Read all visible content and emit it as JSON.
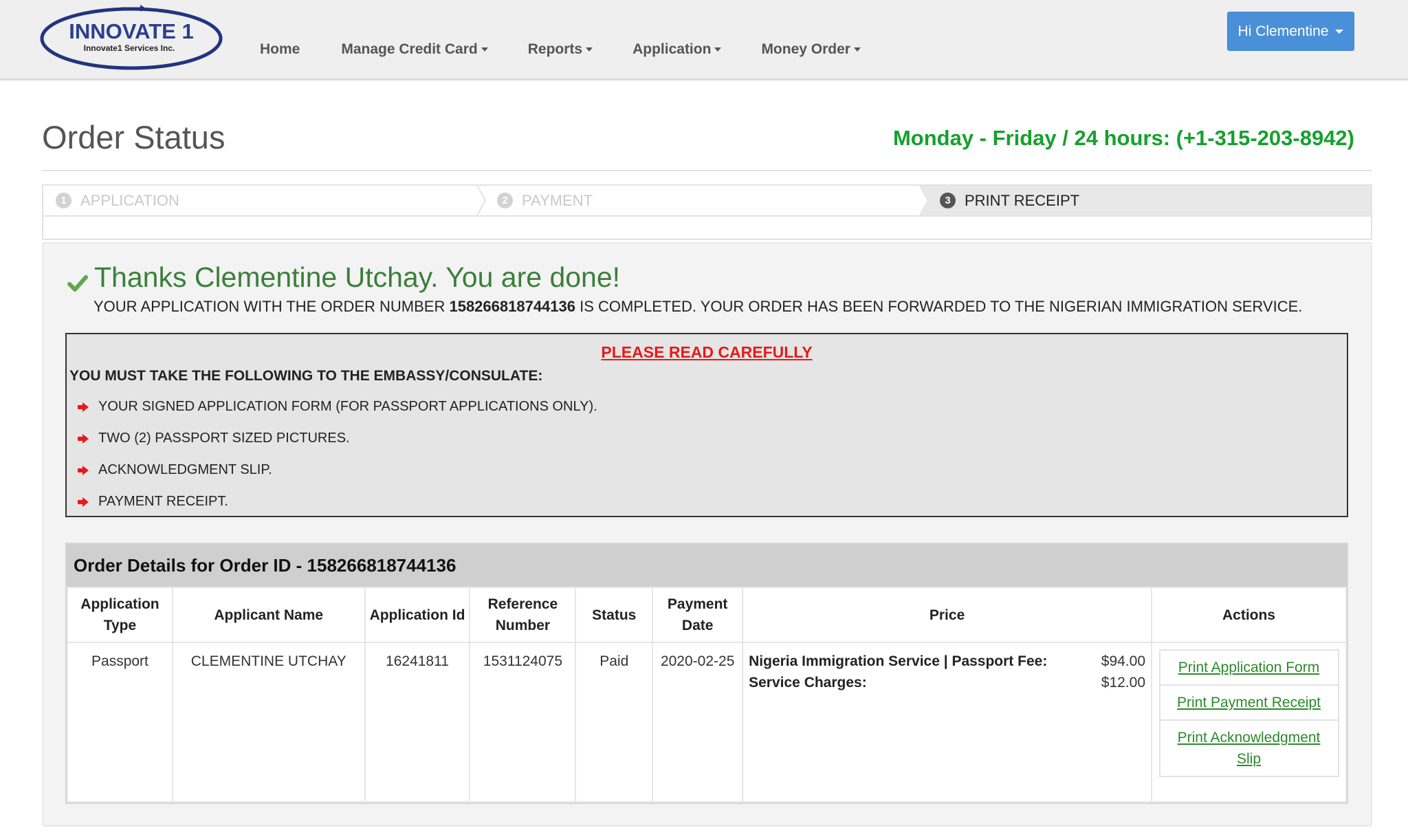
{
  "brand": {
    "name": "INNOVATE 1",
    "tagline": "Innovate1 Services Inc.",
    "color": "#2a3f8f"
  },
  "nav": {
    "items": [
      {
        "label": "Home"
      },
      {
        "label": "Manage Credit Card"
      },
      {
        "label": "Reports"
      },
      {
        "label": "Application"
      },
      {
        "label": "Money Order"
      }
    ],
    "user_label": "Hi Clementine"
  },
  "page": {
    "title": "Order Status",
    "hours": "Monday - Friday / 24 hours: (+1-315-203-8942)"
  },
  "steps": [
    {
      "num": "1",
      "label": "APPLICATION",
      "active": false
    },
    {
      "num": "2",
      "label": "PAYMENT",
      "active": false
    },
    {
      "num": "3",
      "label": "PRINT RECEIPT",
      "active": true
    }
  ],
  "confirmation": {
    "thanks": "Thanks Clementine Utchay. You are done!",
    "line_prefix": "YOUR APPLICATION WITH THE ORDER NUMBER ",
    "order_number": "158266818744136",
    "line_suffix": " IS COMPLETED. YOUR ORDER HAS BEEN FORWARDED TO THE NIGERIAN IMMIGRATION SERVICE."
  },
  "notice": {
    "heading": "PLEASE READ CAREFULLY",
    "subheading": "YOU MUST TAKE THE FOLLOWING TO THE EMBASSY/CONSULATE:",
    "items": [
      "YOUR SIGNED APPLICATION FORM (FOR PASSPORT APPLICATIONS ONLY).",
      "TWO (2) PASSPORT SIZED PICTURES.",
      "ACKNOWLEDGMENT SLIP.",
      "PAYMENT RECEIPT."
    ]
  },
  "order": {
    "heading": "Order Details for Order ID - 158266818744136",
    "columns": [
      "Application Type",
      "Applicant Name",
      "Application Id",
      "Reference Number",
      "Status",
      "Payment Date",
      "Price",
      "Actions"
    ],
    "row": {
      "application_type": "Passport",
      "applicant_name": "CLEMENTINE UTCHAY",
      "application_id": "16241811",
      "reference_number": "1531124075",
      "status": "Paid",
      "payment_date": "2020-02-25",
      "price_lines": [
        {
          "label": "Nigeria Immigration Service | Passport Fee:",
          "amount": "$94.00"
        },
        {
          "label": "Service Charges:",
          "amount": "$12.00"
        }
      ],
      "actions": [
        "Print Application Form",
        "Print Payment Receipt",
        "Print Acknowledgment Slip"
      ]
    }
  },
  "colors": {
    "accent_green": "#16a02e",
    "link_green": "#2a8a2a",
    "user_button": "#4a90d9",
    "warning_red": "#e51a1a"
  }
}
